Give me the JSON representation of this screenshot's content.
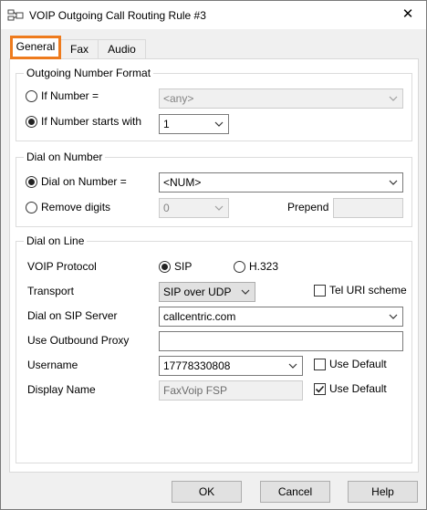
{
  "window": {
    "title": "VOIP Outgoing Call Routing Rule #3",
    "close_symbol": "✕"
  },
  "tabs": [
    {
      "label": "General",
      "active": true
    },
    {
      "label": "Fax",
      "active": false
    },
    {
      "label": "Audio",
      "active": false
    }
  ],
  "outgoing_number_format": {
    "title": "Outgoing Number Format",
    "if_number_label": "If Number =",
    "if_number_value": "<any>",
    "if_number_checked": false,
    "starts_with_label": "If Number starts with",
    "starts_with_value": "1",
    "starts_with_checked": true
  },
  "dial_on_number": {
    "title": "Dial on Number",
    "dial_label": "Dial on Number =",
    "dial_value": "<NUM>",
    "dial_checked": true,
    "remove_label": "Remove digits",
    "remove_value": "0",
    "remove_checked": false,
    "prepend_label": "Prepend",
    "prepend_value": ""
  },
  "dial_on_line": {
    "title": "Dial on Line",
    "protocol_label": "VOIP Protocol",
    "sip_label": "SIP",
    "sip_checked": true,
    "h323_label": "H.323",
    "h323_checked": false,
    "transport_label": "Transport",
    "transport_value": "SIP over UDP",
    "tel_uri_label": "Tel URI scheme",
    "tel_uri_checked": false,
    "server_label": "Dial on SIP Server",
    "server_value": "callcentric.com",
    "proxy_label": "Use Outbound Proxy",
    "proxy_value": "",
    "username_label": "Username",
    "username_value": "17778330808",
    "username_default_label": "Use Default",
    "username_default_checked": false,
    "display_label": "Display Name",
    "display_value": "FaxVoip FSP",
    "display_default_label": "Use Default",
    "display_default_checked": true
  },
  "buttons": {
    "ok": "OK",
    "cancel": "Cancel",
    "help": "Help"
  },
  "colors": {
    "active_tab_highlight": "#ee7b1d",
    "window_bg": "#f0f0f0",
    "panel_bg": "#ffffff"
  }
}
